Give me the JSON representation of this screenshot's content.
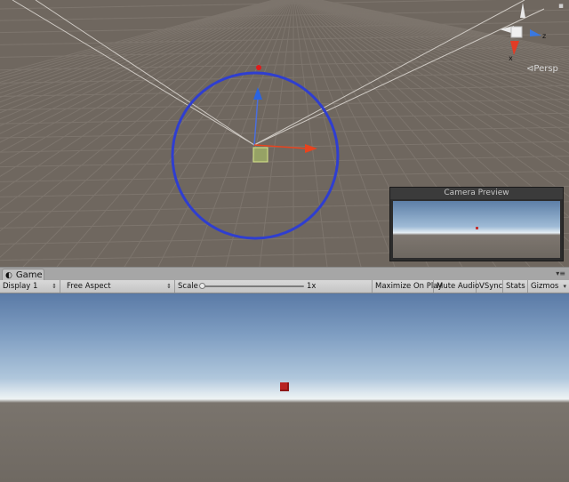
{
  "scene": {
    "orientation_label": "Persp",
    "gizmo_axes": {
      "z_label": "z",
      "x_label": "x"
    },
    "icons": [
      "pane-menu-icon",
      "orientation-gizmo-icon",
      "move-handle-icon",
      "camera-icon"
    ],
    "colors": {
      "background": "#6f675f",
      "grid": "#7b736b",
      "circle": "#2b3bd0",
      "x_axis": "#e8431e",
      "y_axis": "#2a67e0",
      "z_axis": "#3a78e0"
    }
  },
  "camera_preview": {
    "title": "Camera Preview"
  },
  "game_panel": {
    "tab_label": "Game",
    "toolbar": {
      "display": "Display 1",
      "aspect": "Free Aspect",
      "scale_label": "Scale",
      "scale_value": "1x",
      "scale_level": 0.0,
      "maximize_label": "Maximize On Play",
      "mute_label": "Mute Audio",
      "vsync_label": "VSync",
      "stats_label": "Stats",
      "gizmos_label": "Gizmos"
    },
    "colors": {
      "sky_top": "#5a7aa6",
      "horizon": "#eef3f4",
      "ground": "#6f6962",
      "cube": "#b82323"
    }
  }
}
